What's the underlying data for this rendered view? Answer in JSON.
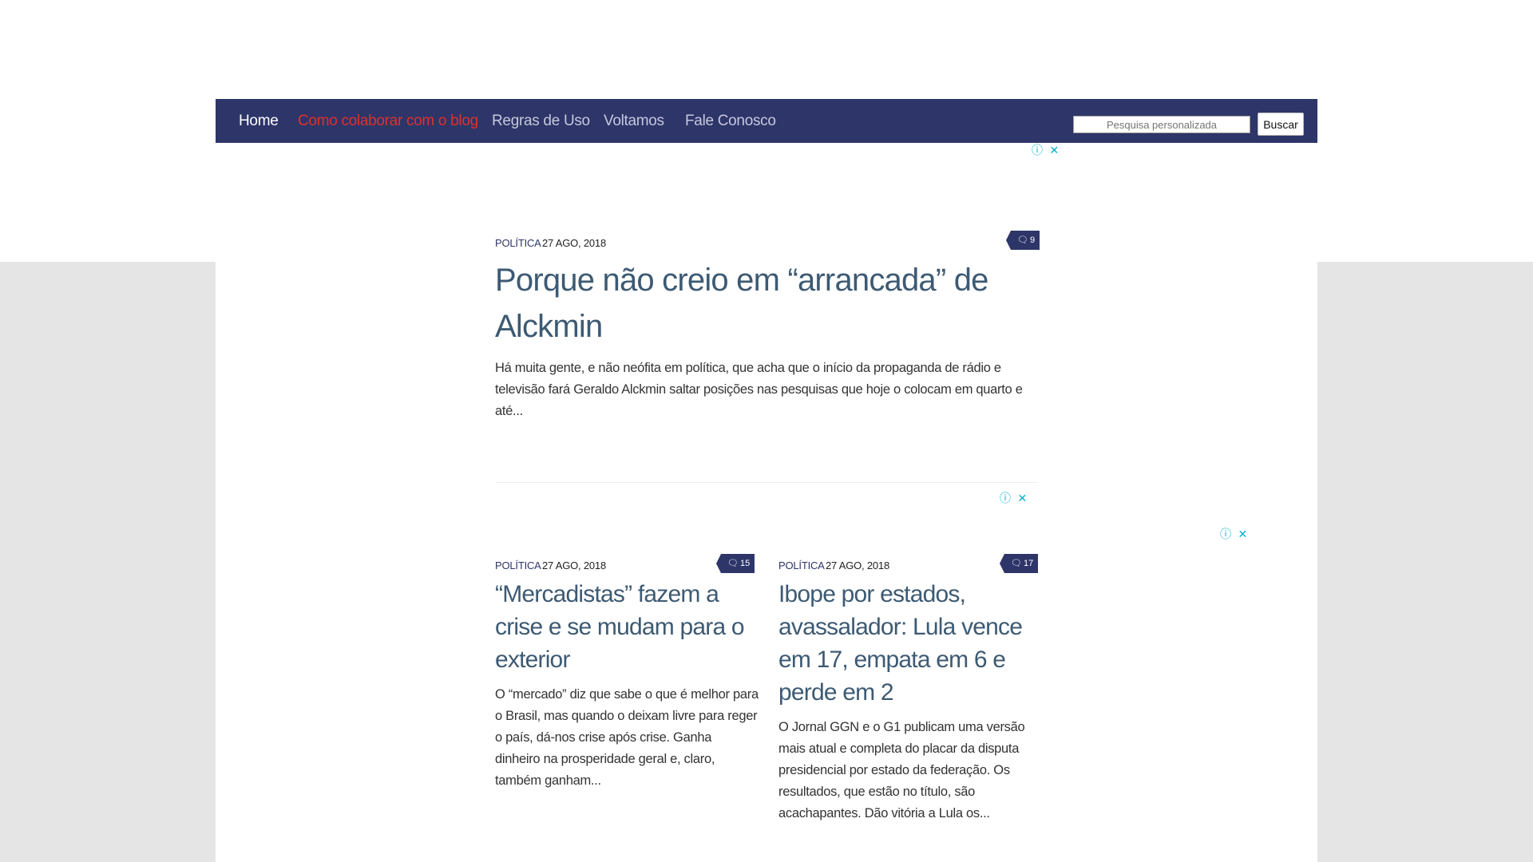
{
  "nav": {
    "items": [
      {
        "label": "Home"
      },
      {
        "label": "Como colaborar com o blog"
      },
      {
        "label": "Regras de Uso"
      },
      {
        "label": "Voltamos"
      },
      {
        "label": "Fale Conosco"
      }
    ],
    "active_color": "#e0302a",
    "bar_color": "#2e3569"
  },
  "search": {
    "placeholder": "Pesquisa personalizada",
    "button_label": "Buscar"
  },
  "ads": {
    "close_label": "ⓘ ✕"
  },
  "posts": [
    {
      "category": "POLÍTICA",
      "date": "27 AGO, 2018",
      "comments": "9",
      "title": "Porque não creio em “arrancada” de Alckmin",
      "excerpt": "Há muita gente, e  não neófita em política, que acha que o início da propaganda de rádio e televisão fará Geraldo Alckmin saltar posições nas pesquisas que hoje o colocam em quarto e até..."
    },
    {
      "category": "POLÍTICA",
      "date": "27 AGO, 2018",
      "comments": "15",
      "title": "“Mercadistas” fazem a crise e se mudam para o exterior",
      "excerpt": "O “mercado” diz que sabe o que é melhor para o Brasil, mas quando o deixam livre para reger o país, dá-nos crise após  crise. Ganha dinheiro na prosperidade geral e, claro, também ganham..."
    },
    {
      "category": "POLÍTICA",
      "date": "27 AGO, 2018",
      "comments": "17",
      "title": "Ibope por estados, avassalador: Lula vence em 17, empata em 6 e perde em 2",
      "excerpt": "O Jornal GGN e o G1 publicam uma versão mais atual e completa do placar da disputa presidencial por estado da federação. Os resultados, que estão no título, são acachapantes. Dão vitória a Lula os..."
    }
  ]
}
